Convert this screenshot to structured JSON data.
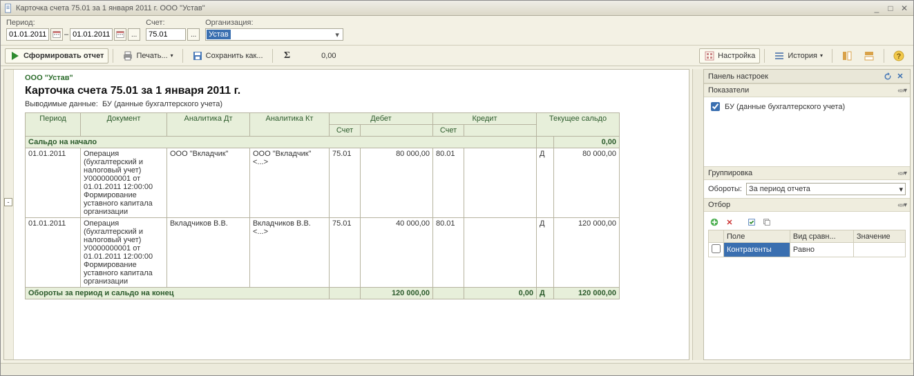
{
  "title": "Карточка счета 75.01 за 1 января 2011 г. ООО \"Устав\"",
  "params": {
    "period_label": "Период:",
    "date_from": "01.01.2011",
    "date_to": "01.01.2011",
    "account_label": "Счет:",
    "account": "75.01",
    "org_label": "Организация:",
    "org_value": "Устав"
  },
  "toolbar": {
    "form": "Сформировать отчет",
    "print": "Печать...",
    "save": "Сохранить как...",
    "sum": "0,00",
    "settings": "Настройка",
    "history": "История"
  },
  "report": {
    "org_name": "ООО \"Устав\"",
    "title": "Карточка счета 75.01 за 1 января 2011 г.",
    "subtitle_label": "Выводимые данные:",
    "subtitle_value": "БУ (данные бухгалтерского учета)",
    "headers": {
      "period": "Период",
      "doc": "Документ",
      "adt": "Аналитика Дт",
      "akt": "Аналитика Кт",
      "debit": "Дебет",
      "credit": "Кредит",
      "saldo": "Текущее сальдо",
      "acc": "Счет"
    },
    "start_row": {
      "label": "Сальдо на начало",
      "value": "0,00"
    },
    "rows": [
      {
        "period": "01.01.2011",
        "doc": "Операция (бухгалтерский и налоговый учет) У0000000001 от 01.01.2011 12:00:00\nФормирование уставного капитала организации",
        "adt": "ООО \"Вкладчик\"",
        "akt": "ООО \"Вкладчик\"\n<...>",
        "dacc": "75.01",
        "dval": "80 000,00",
        "cacc": "80.01",
        "cval": "",
        "s_dk": "Д",
        "s_val": "80 000,00"
      },
      {
        "period": "01.01.2011",
        "doc": "Операция (бухгалтерский и налоговый учет) У0000000001 от 01.01.2011 12:00:00\nФормирование уставного капитала организации",
        "adt": "Вкладчиков В.В.",
        "akt": "Вкладчиков В.В.\n<...>",
        "dacc": "75.01",
        "dval": "40 000,00",
        "cacc": "80.01",
        "cval": "",
        "s_dk": "Д",
        "s_val": "120 000,00"
      }
    ],
    "totals": {
      "label": "Обороты за период и сальдо на конец",
      "d": "120 000,00",
      "c": "0,00",
      "s_dk": "Д",
      "s_val": "120 000,00"
    }
  },
  "panel": {
    "title": "Панель настроек",
    "sect_ind": "Показатели",
    "ind_item": "БУ (данные бухгалтерского учета)",
    "sect_group": "Группировка",
    "group_label": "Обороты:",
    "group_value": "За период отчета",
    "sect_filter": "Отбор",
    "filter_headers": {
      "field": "Поле",
      "cmp": "Вид сравн...",
      "val": "Значение"
    },
    "filter_row": {
      "field": "Контрагенты",
      "cmp": "Равно",
      "val": ""
    }
  }
}
